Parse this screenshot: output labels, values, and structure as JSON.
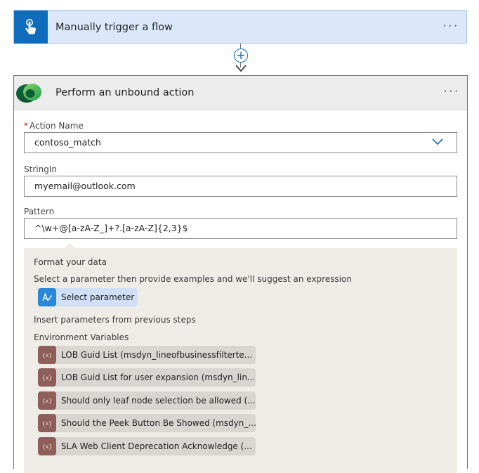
{
  "trigger": {
    "title": "Manually trigger a flow",
    "more": "···",
    "icon": "touch-hand-icon",
    "color": "#0f6cbd"
  },
  "action": {
    "title": "Perform an unbound action",
    "more": "···",
    "icon": "dataverse-logo-icon"
  },
  "fields": {
    "action_name": {
      "label": "Action Name",
      "required_mark": "*",
      "value": "contoso_match"
    },
    "string_in": {
      "label": "StringIn",
      "value": "myemail@outlook.com"
    },
    "pattern": {
      "label": "Pattern",
      "value": "^\\w+@[a-zA-Z_]+?.[a-zA-Z]{2,3}$"
    }
  },
  "panel": {
    "format_heading": "Format your data",
    "format_hint": "Select a parameter then provide examples and we'll suggest an expression",
    "select_param_label": "Select parameter",
    "insert_heading": "Insert parameters from previous steps",
    "env_heading": "Environment Variables",
    "env_icon_text": "{x}",
    "env_vars": [
      "LOB Guid List (msdyn_lineofbusinessfilterte...",
      "LOB Guid List for user expansion (msdyn_lin...",
      "Should only leaf node selection be allowed (...",
      "Should the Peek Button Be Showed (msdyn_...",
      "SLA Web Client Deprecation Acknowledge (..."
    ]
  }
}
